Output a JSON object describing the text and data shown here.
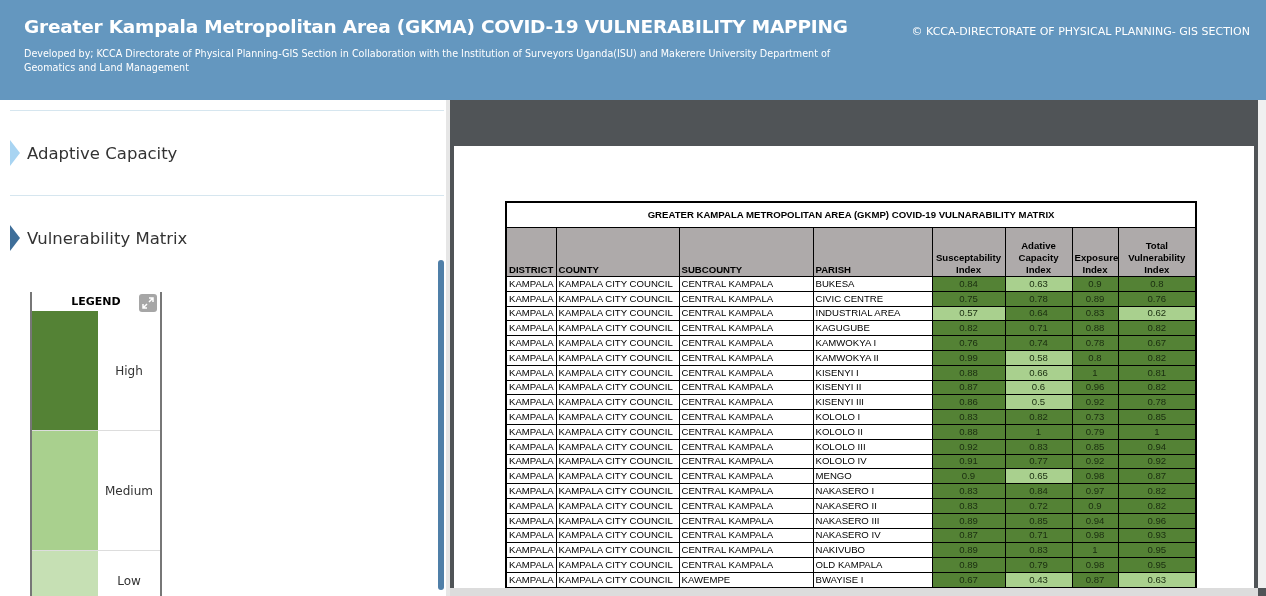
{
  "header": {
    "title": "Greater Kampala Metropolitan Area (GKMA) COVID-19 VULNERABILITY MAPPING",
    "subtitle": "Developed by; KCCA Directorate of Physical Planning-GIS Section in Collaboration with the Institution of Surveyors Uganda(ISU) and Makerere University Department of Geomatics and Land Management",
    "copyright": "© KCCA-DIRECTORATE OF PHYSICAL PLANNING- GIS SECTION"
  },
  "sections": [
    {
      "label": "Adaptive Capacity",
      "expanded": false
    },
    {
      "label": "Vulnerability Matrix",
      "expanded": true
    }
  ],
  "legend": {
    "title": "LEGEND",
    "items": [
      {
        "label": "High",
        "color": "#548235"
      },
      {
        "label": "Medium",
        "color": "#a9d08e"
      },
      {
        "label": "Low",
        "color": "#c6e0b4"
      }
    ]
  },
  "matrix": {
    "title": "GREATER KAMPALA METROPOLITAN AREA (GKMP) COVID-19 VULNARABILITY MATRIX",
    "columns": [
      "DISTRICT",
      "COUNTY",
      "SUBCOUNTY",
      "PARISH",
      "Susceptability Index",
      "Adative Capacity Index",
      "Exposure Index",
      "Total Vulnerability Index"
    ],
    "rows": [
      {
        "district": "KAMPALA",
        "county": "KAMPALA CITY COUNCIL",
        "subcounty": "CENTRAL KAMPALA",
        "parish": "BUKESA",
        "indices": [
          {
            "value": "0.84",
            "color": "#548235"
          },
          {
            "value": "0.63",
            "color": "#a9d08e"
          },
          {
            "value": "0.9",
            "color": "#548235"
          },
          {
            "value": "0.8",
            "color": "#548235"
          }
        ]
      },
      {
        "district": "KAMPALA",
        "county": "KAMPALA CITY COUNCIL",
        "subcounty": "CENTRAL KAMPALA",
        "parish": "CIVIC CENTRE",
        "indices": [
          {
            "value": "0.75",
            "color": "#548235"
          },
          {
            "value": "0.78",
            "color": "#548235"
          },
          {
            "value": "0.89",
            "color": "#548235"
          },
          {
            "value": "0.76",
            "color": "#548235"
          }
        ]
      },
      {
        "district": "KAMPALA",
        "county": "KAMPALA CITY COUNCIL",
        "subcounty": "CENTRAL KAMPALA",
        "parish": "INDUSTRIAL AREA",
        "indices": [
          {
            "value": "0.57",
            "color": "#a9d08e"
          },
          {
            "value": "0.64",
            "color": "#548235"
          },
          {
            "value": "0.83",
            "color": "#548235"
          },
          {
            "value": "0.62",
            "color": "#a9d08e"
          }
        ]
      },
      {
        "district": "KAMPALA",
        "county": "KAMPALA CITY COUNCIL",
        "subcounty": "CENTRAL KAMPALA",
        "parish": "KAGUGUBE",
        "indices": [
          {
            "value": "0.82",
            "color": "#548235"
          },
          {
            "value": "0.71",
            "color": "#548235"
          },
          {
            "value": "0.88",
            "color": "#548235"
          },
          {
            "value": "0.82",
            "color": "#548235"
          }
        ]
      },
      {
        "district": "KAMPALA",
        "county": "KAMPALA CITY COUNCIL",
        "subcounty": "CENTRAL KAMPALA",
        "parish": "KAMWOKYA I",
        "indices": [
          {
            "value": "0.76",
            "color": "#548235"
          },
          {
            "value": "0.74",
            "color": "#548235"
          },
          {
            "value": "0.78",
            "color": "#548235"
          },
          {
            "value": "0.67",
            "color": "#548235"
          }
        ]
      },
      {
        "district": "KAMPALA",
        "county": "KAMPALA CITY COUNCIL",
        "subcounty": "CENTRAL KAMPALA",
        "parish": "KAMWOKYA II",
        "indices": [
          {
            "value": "0.99",
            "color": "#548235"
          },
          {
            "value": "0.58",
            "color": "#a9d08e"
          },
          {
            "value": "0.8",
            "color": "#548235"
          },
          {
            "value": "0.82",
            "color": "#548235"
          }
        ]
      },
      {
        "district": "KAMPALA",
        "county": "KAMPALA CITY COUNCIL",
        "subcounty": "CENTRAL KAMPALA",
        "parish": "KISENYI I",
        "indices": [
          {
            "value": "0.88",
            "color": "#548235"
          },
          {
            "value": "0.66",
            "color": "#a9d08e"
          },
          {
            "value": "1",
            "color": "#548235"
          },
          {
            "value": "0.81",
            "color": "#548235"
          }
        ]
      },
      {
        "district": "KAMPALA",
        "county": "KAMPALA CITY COUNCIL",
        "subcounty": "CENTRAL KAMPALA",
        "parish": "KISENYI II",
        "indices": [
          {
            "value": "0.87",
            "color": "#548235"
          },
          {
            "value": "0.6",
            "color": "#a9d08e"
          },
          {
            "value": "0.96",
            "color": "#548235"
          },
          {
            "value": "0.82",
            "color": "#548235"
          }
        ]
      },
      {
        "district": "KAMPALA",
        "county": "KAMPALA CITY COUNCIL",
        "subcounty": "CENTRAL KAMPALA",
        "parish": "KISENYI III",
        "indices": [
          {
            "value": "0.86",
            "color": "#548235"
          },
          {
            "value": "0.5",
            "color": "#a9d08e"
          },
          {
            "value": "0.92",
            "color": "#548235"
          },
          {
            "value": "0.78",
            "color": "#548235"
          }
        ]
      },
      {
        "district": "KAMPALA",
        "county": "KAMPALA CITY COUNCIL",
        "subcounty": "CENTRAL KAMPALA",
        "parish": "KOLOLO I",
        "indices": [
          {
            "value": "0.83",
            "color": "#548235"
          },
          {
            "value": "0.82",
            "color": "#548235"
          },
          {
            "value": "0.73",
            "color": "#548235"
          },
          {
            "value": "0.85",
            "color": "#548235"
          }
        ]
      },
      {
        "district": "KAMPALA",
        "county": "KAMPALA CITY COUNCIL",
        "subcounty": "CENTRAL KAMPALA",
        "parish": "KOLOLO II",
        "indices": [
          {
            "value": "0.88",
            "color": "#548235"
          },
          {
            "value": "1",
            "color": "#548235"
          },
          {
            "value": "0.79",
            "color": "#548235"
          },
          {
            "value": "1",
            "color": "#548235"
          }
        ]
      },
      {
        "district": "KAMPALA",
        "county": "KAMPALA CITY COUNCIL",
        "subcounty": "CENTRAL KAMPALA",
        "parish": "KOLOLO III",
        "indices": [
          {
            "value": "0.92",
            "color": "#548235"
          },
          {
            "value": "0.83",
            "color": "#548235"
          },
          {
            "value": "0.85",
            "color": "#548235"
          },
          {
            "value": "0.94",
            "color": "#548235"
          }
        ]
      },
      {
        "district": "KAMPALA",
        "county": "KAMPALA CITY COUNCIL",
        "subcounty": "CENTRAL KAMPALA",
        "parish": "KOLOLO IV",
        "indices": [
          {
            "value": "0.91",
            "color": "#548235"
          },
          {
            "value": "0.77",
            "color": "#548235"
          },
          {
            "value": "0.92",
            "color": "#548235"
          },
          {
            "value": "0.92",
            "color": "#548235"
          }
        ]
      },
      {
        "district": "KAMPALA",
        "county": "KAMPALA CITY COUNCIL",
        "subcounty": "CENTRAL KAMPALA",
        "parish": "MENGO",
        "indices": [
          {
            "value": "0.9",
            "color": "#548235"
          },
          {
            "value": "0.65",
            "color": "#a9d08e"
          },
          {
            "value": "0.98",
            "color": "#548235"
          },
          {
            "value": "0.87",
            "color": "#548235"
          }
        ]
      },
      {
        "district": "KAMPALA",
        "county": "KAMPALA CITY COUNCIL",
        "subcounty": "CENTRAL KAMPALA",
        "parish": "NAKASERO I",
        "indices": [
          {
            "value": "0.83",
            "color": "#548235"
          },
          {
            "value": "0.84",
            "color": "#548235"
          },
          {
            "value": "0.97",
            "color": "#548235"
          },
          {
            "value": "0.82",
            "color": "#548235"
          }
        ]
      },
      {
        "district": "KAMPALA",
        "county": "KAMPALA CITY COUNCIL",
        "subcounty": "CENTRAL KAMPALA",
        "parish": "NAKASERO II",
        "indices": [
          {
            "value": "0.83",
            "color": "#548235"
          },
          {
            "value": "0.72",
            "color": "#548235"
          },
          {
            "value": "0.9",
            "color": "#548235"
          },
          {
            "value": "0.82",
            "color": "#548235"
          }
        ]
      },
      {
        "district": "KAMPALA",
        "county": "KAMPALA CITY COUNCIL",
        "subcounty": "CENTRAL KAMPALA",
        "parish": "NAKASERO III",
        "indices": [
          {
            "value": "0.89",
            "color": "#548235"
          },
          {
            "value": "0.85",
            "color": "#548235"
          },
          {
            "value": "0.94",
            "color": "#548235"
          },
          {
            "value": "0.96",
            "color": "#548235"
          }
        ]
      },
      {
        "district": "KAMPALA",
        "county": "KAMPALA CITY COUNCIL",
        "subcounty": "CENTRAL KAMPALA",
        "parish": "NAKASERO IV",
        "indices": [
          {
            "value": "0.87",
            "color": "#548235"
          },
          {
            "value": "0.71",
            "color": "#548235"
          },
          {
            "value": "0.98",
            "color": "#548235"
          },
          {
            "value": "0.93",
            "color": "#548235"
          }
        ]
      },
      {
        "district": "KAMPALA",
        "county": "KAMPALA CITY COUNCIL",
        "subcounty": "CENTRAL KAMPALA",
        "parish": "NAKIVUBO",
        "indices": [
          {
            "value": "0.89",
            "color": "#548235"
          },
          {
            "value": "0.83",
            "color": "#548235"
          },
          {
            "value": "1",
            "color": "#548235"
          },
          {
            "value": "0.95",
            "color": "#548235"
          }
        ]
      },
      {
        "district": "KAMPALA",
        "county": "KAMPALA CITY COUNCIL",
        "subcounty": "CENTRAL KAMPALA",
        "parish": "OLD KAMPALA",
        "indices": [
          {
            "value": "0.89",
            "color": "#548235"
          },
          {
            "value": "0.79",
            "color": "#548235"
          },
          {
            "value": "0.98",
            "color": "#548235"
          },
          {
            "value": "0.95",
            "color": "#548235"
          }
        ]
      },
      {
        "district": "KAMPALA",
        "county": "KAMPALA CITY COUNCIL",
        "subcounty": "KAWEMPE",
        "parish": "BWAYISE I",
        "indices": [
          {
            "value": "0.67",
            "color": "#548235"
          },
          {
            "value": "0.43",
            "color": "#a9d08e"
          },
          {
            "value": "0.87",
            "color": "#548235"
          },
          {
            "value": "0.63",
            "color": "#a9d08e"
          }
        ]
      }
    ]
  }
}
